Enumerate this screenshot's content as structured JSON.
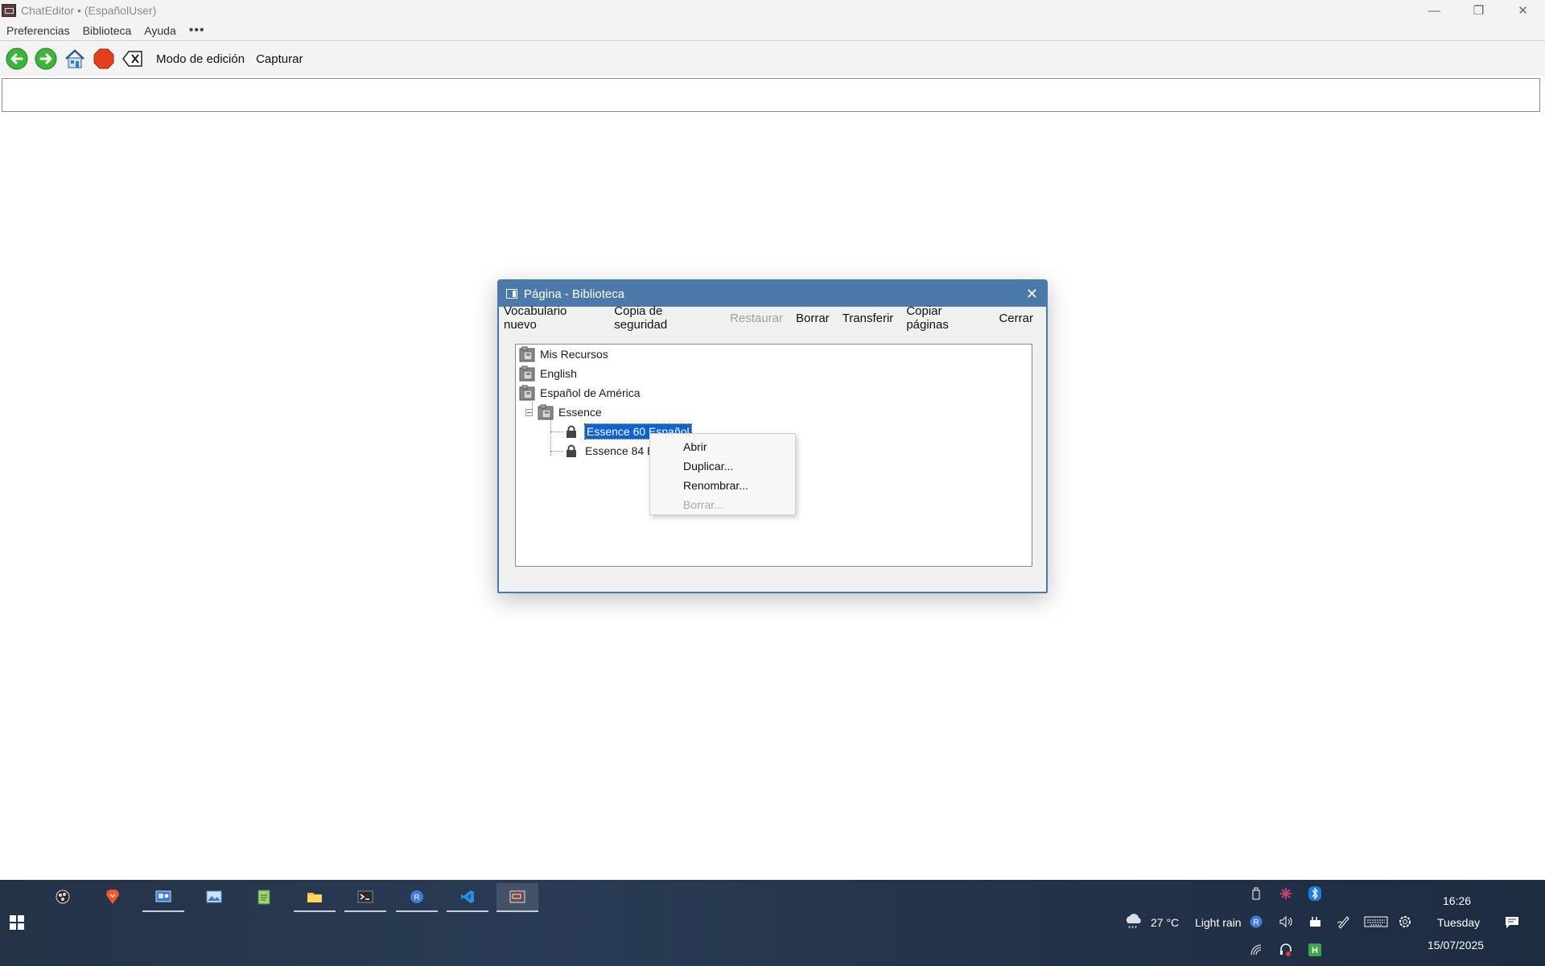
{
  "window": {
    "title": "ChatEditor • (EspañolUser)",
    "controls": [
      "—",
      "❐",
      "✕"
    ]
  },
  "menubar": {
    "items": [
      "Preferencias",
      "Biblioteca",
      "Ayuda"
    ],
    "more": "•••"
  },
  "toolbar": {
    "icons": [
      "back-arrow-icon",
      "forward-arrow-icon",
      "home-icon",
      "stop-icon",
      "clear-icon"
    ],
    "edit_mode_label": "Modo de edición",
    "capture_label": "Capturar"
  },
  "dialog": {
    "title": "Página - Biblioteca",
    "close": "✕",
    "menu": [
      "Vocabulario nuevo",
      "Copia de seguridad",
      "Restaurar",
      "Borrar",
      "Transferir",
      "Copiar páginas",
      "Cerrar"
    ],
    "menu_disabled": [
      "Restaurar"
    ],
    "tree": {
      "root_items": [
        "Mis Recursos",
        "English",
        "Español de América"
      ],
      "child_folder": "Essence",
      "vocabularies": [
        "Essence 60 Español",
        "Essence 84 Es"
      ],
      "selected": "Essence 60 Español"
    }
  },
  "context_menu": {
    "items": [
      "Abrir",
      "Duplicar...",
      "Renombrar...",
      "Borrar..."
    ],
    "disabled": [
      "Borrar..."
    ]
  },
  "taskbar": {
    "apps": [
      "obs-icon",
      "brave-icon",
      "control-panel-icon",
      "photos-icon",
      "notepad-icon",
      "file-explorer-icon",
      "terminal-icon",
      "r-app-icon",
      "vscode-icon",
      "chateditor-icon"
    ],
    "weather": {
      "temperature": "27 °C",
      "condition": "Light rain"
    },
    "clock": {
      "time": "16:26",
      "day": "Tuesday",
      "date": "15/07/2025"
    }
  },
  "colors": {
    "dialog_title_bg": "#4a79aa",
    "selection_bg": "#0a62d6",
    "taskbar_bg": "#24344c"
  }
}
